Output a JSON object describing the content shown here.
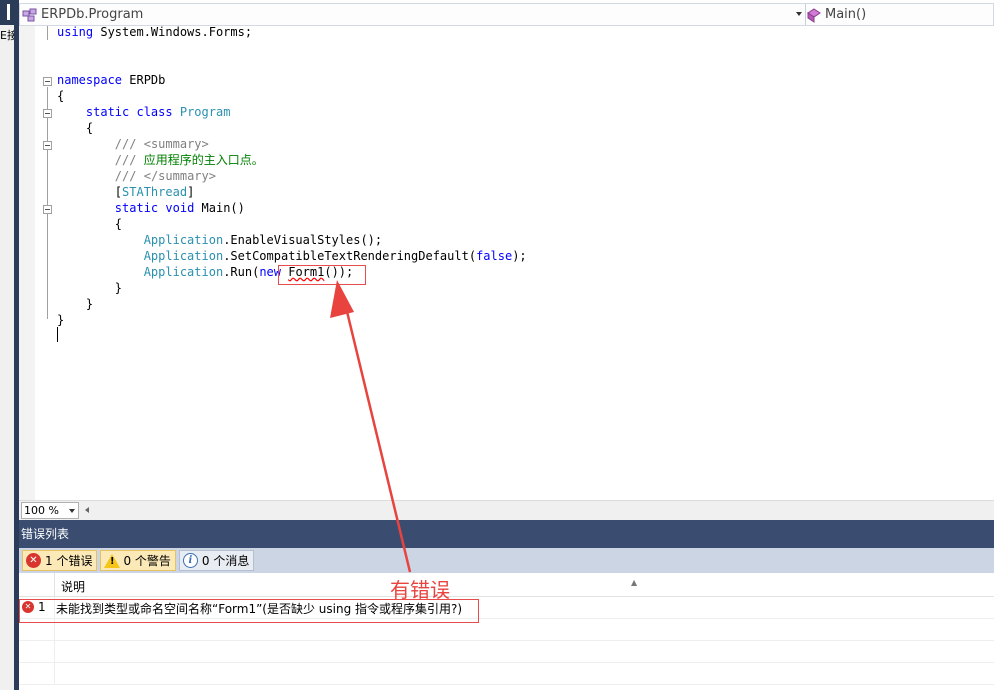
{
  "left_strip": {
    "cut_label": "E接"
  },
  "nav": {
    "type_combo": "ERPDb.Program",
    "member_combo": "Main()"
  },
  "code": {
    "lines": [
      {
        "tokens": [
          {
            "t": "using",
            "c": "kw"
          },
          {
            "t": " System.Windows.Forms;",
            "c": ""
          }
        ]
      },
      {
        "tokens": []
      },
      {
        "tokens": []
      },
      {
        "tokens": [
          {
            "t": "namespace",
            "c": "kw"
          },
          {
            "t": " ERPDb",
            "c": ""
          }
        ]
      },
      {
        "tokens": [
          {
            "t": "{",
            "c": ""
          }
        ]
      },
      {
        "tokens": [
          {
            "t": "    static",
            "c": "kw"
          },
          {
            "t": " ",
            "c": ""
          },
          {
            "t": "class",
            "c": "kw"
          },
          {
            "t": " ",
            "c": ""
          },
          {
            "t": "Program",
            "c": "ty"
          }
        ]
      },
      {
        "tokens": [
          {
            "t": "    {",
            "c": ""
          }
        ]
      },
      {
        "tokens": [
          {
            "t": "        ///",
            "c": "cg"
          },
          {
            "t": " ",
            "c": ""
          },
          {
            "t": "<summary>",
            "c": "cg"
          }
        ]
      },
      {
        "tokens": [
          {
            "t": "        ///",
            "c": "cg"
          },
          {
            "t": " 应用程序的主入口点。",
            "c": "cm"
          }
        ]
      },
      {
        "tokens": [
          {
            "t": "        ///",
            "c": "cg"
          },
          {
            "t": " ",
            "c": ""
          },
          {
            "t": "</summary>",
            "c": "cg"
          }
        ]
      },
      {
        "tokens": [
          {
            "t": "        [",
            "c": ""
          },
          {
            "t": "STAThread",
            "c": "ty"
          },
          {
            "t": "]",
            "c": ""
          }
        ]
      },
      {
        "tokens": [
          {
            "t": "        static",
            "c": "kw"
          },
          {
            "t": " ",
            "c": ""
          },
          {
            "t": "void",
            "c": "kw"
          },
          {
            "t": " Main()",
            "c": ""
          }
        ]
      },
      {
        "tokens": [
          {
            "t": "        {",
            "c": ""
          }
        ]
      },
      {
        "tokens": [
          {
            "t": "            ",
            "c": ""
          },
          {
            "t": "Application",
            "c": "ty"
          },
          {
            "t": ".EnableVisualStyles();",
            "c": ""
          }
        ]
      },
      {
        "tokens": [
          {
            "t": "            ",
            "c": ""
          },
          {
            "t": "Application",
            "c": "ty"
          },
          {
            "t": ".SetCompatibleTextRenderingDefault(",
            "c": ""
          },
          {
            "t": "false",
            "c": "kw"
          },
          {
            "t": ");",
            "c": ""
          }
        ]
      },
      {
        "tokens": [
          {
            "t": "            ",
            "c": ""
          },
          {
            "t": "Application",
            "c": "ty"
          },
          {
            "t": ".Run(",
            "c": ""
          },
          {
            "t": "new",
            "c": "kw"
          },
          {
            "t": " ",
            "c": ""
          },
          {
            "t": "Form1",
            "c": "squiggle"
          },
          {
            "t": "());",
            "c": ""
          }
        ]
      },
      {
        "tokens": [
          {
            "t": "        }",
            "c": ""
          }
        ]
      },
      {
        "tokens": [
          {
            "t": "    }",
            "c": ""
          }
        ]
      },
      {
        "tokens": [
          {
            "t": "}",
            "c": ""
          }
        ]
      }
    ]
  },
  "zoom": {
    "value": "100 %"
  },
  "error_list": {
    "title": "错误列表",
    "filters": [
      {
        "label": "1 个错误",
        "icon": "error-icon",
        "active": true
      },
      {
        "label": "0 个警告",
        "icon": "warning-icon",
        "active": true
      },
      {
        "label": "0 个消息",
        "icon": "info-icon",
        "active": false
      }
    ],
    "header": {
      "description": "说明"
    },
    "rows": [
      {
        "num": "1",
        "description": "未能找到类型或命名空间名称“Form1”(是否缺少 using 指令或程序集引用?)"
      }
    ]
  },
  "annotation": {
    "label": "有错误",
    "color": "#e8433f"
  }
}
